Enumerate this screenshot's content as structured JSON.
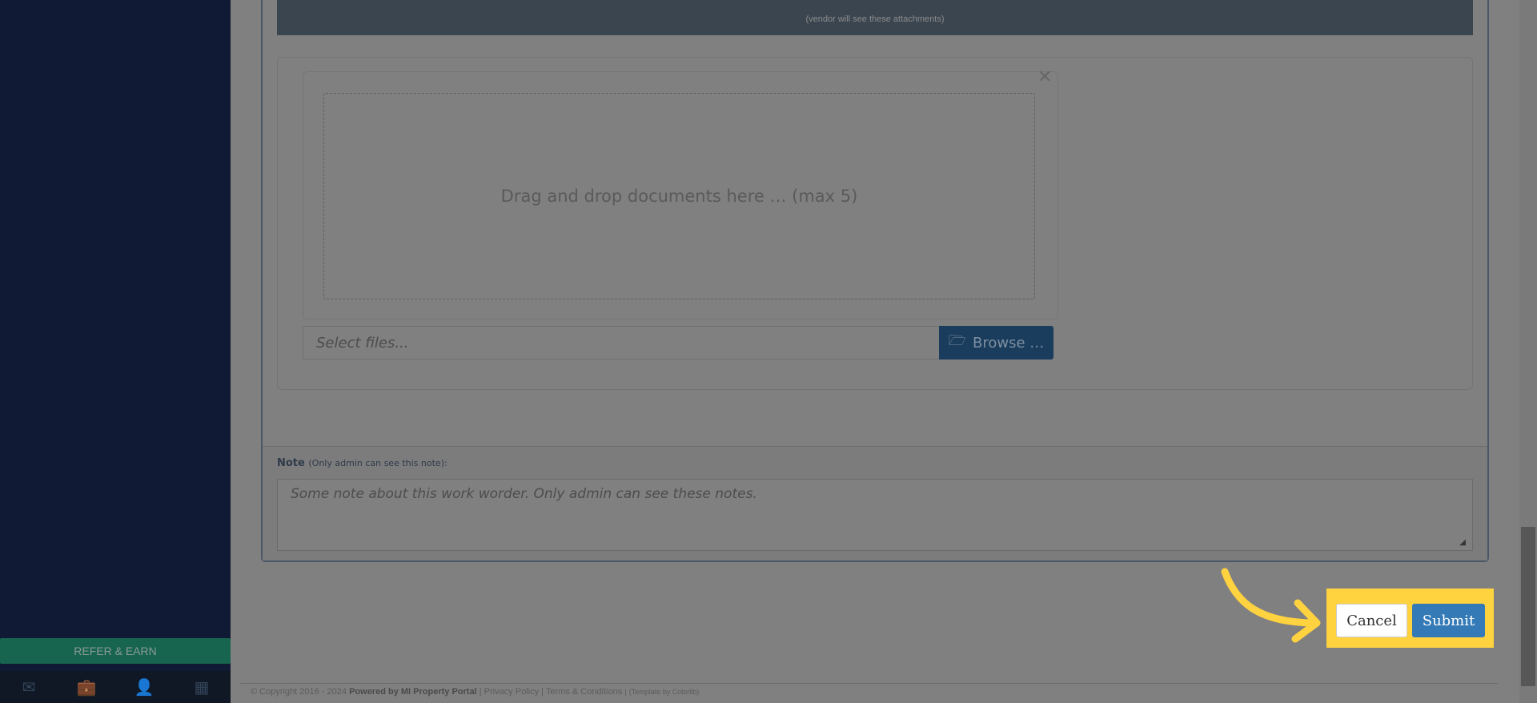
{
  "sidebar": {
    "refer_label": "REFER & EARN",
    "footer_icons": [
      "envelope-icon",
      "briefcase-icon",
      "user-icon",
      "calculator-icon"
    ]
  },
  "attachments": {
    "banner_note": "(vendor will see these attachments)",
    "dropzone_text": "Drag and drop documents here … (max 5)",
    "select_placeholder": "Select files...",
    "browse_label": "Browse …"
  },
  "note": {
    "label": "Note",
    "sublabel": "(Only admin can see this note):",
    "placeholder": "Some note about this work worder. Only admin can see these notes."
  },
  "actions": {
    "cancel": "Cancel",
    "submit": "Submit"
  },
  "footer": {
    "copyright": "© Copyright 2016 - 2024",
    "powered": "Powered by MI Property Portal",
    "sep": "|",
    "privacy": "Privacy Policy",
    "terms": "Terms & Conditions",
    "template": "(Template by Colorlib)"
  },
  "colors": {
    "highlight": "#ffd23f",
    "submit": "#337ab7",
    "sidebar": "#111a35",
    "refer": "#18654f"
  }
}
